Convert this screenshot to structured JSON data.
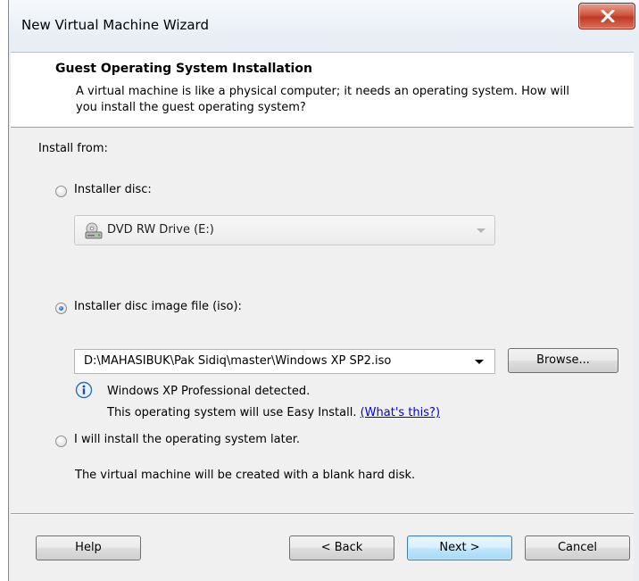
{
  "window": {
    "title": "New Virtual Machine Wizard"
  },
  "header": {
    "title": "Guest Operating System Installation",
    "description": "A virtual machine is like a physical computer; it needs an operating system. How will you install the guest operating system?"
  },
  "install_from": {
    "label": "Install from:",
    "options": [
      {
        "label": "Installer disc:",
        "selected": false
      },
      {
        "label": "Installer disc image file (iso):",
        "selected": true
      },
      {
        "label": "I will install the operating system later.",
        "selected": false
      }
    ],
    "disc_drive": {
      "value": "DVD RW Drive (E:)",
      "icon": "dvd-drive-icon",
      "enabled": false
    },
    "iso_path": {
      "value": "D:\\MAHASIBUK\\Pak Sidiq\\master\\Windows XP SP2.iso"
    },
    "browse_label": "Browse...",
    "detected_line1": "Windows XP Professional detected.",
    "detected_line2": "This operating system will use Easy Install.",
    "whats_this": "(What's this?)",
    "later_note": "The virtual machine will be created with a blank hard disk."
  },
  "footer": {
    "help": "Help",
    "back": "< Back",
    "next": "Next >",
    "cancel": "Cancel"
  },
  "colors": {
    "close_button": "#c9432b",
    "link": "#0000ee",
    "default_button_border": "#3c7fb1"
  }
}
